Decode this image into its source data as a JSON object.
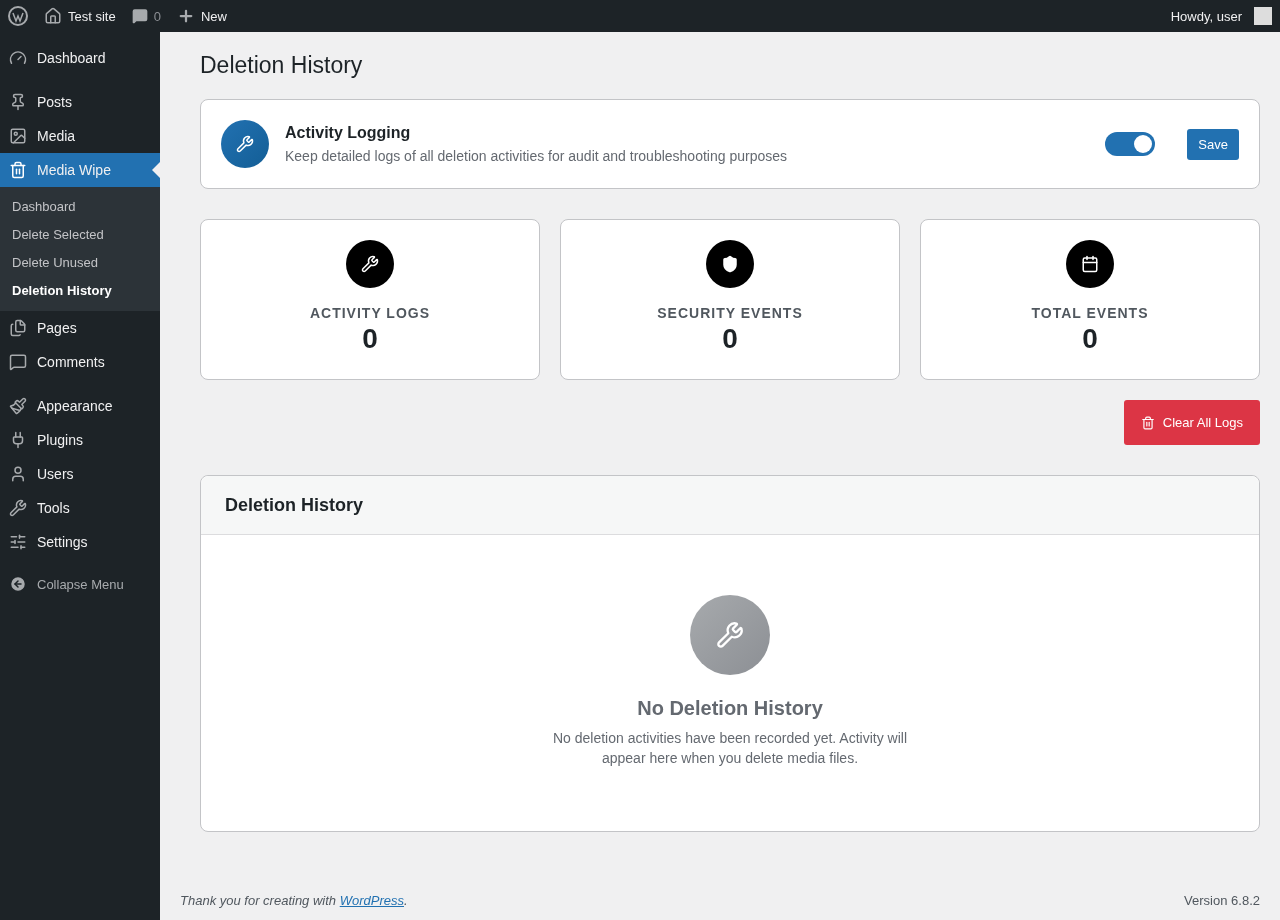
{
  "admin_bar": {
    "site_name": "Test site",
    "comments_count": "0",
    "new_label": "New",
    "greeting": "Howdy, user"
  },
  "sidebar": {
    "groups": [
      [
        {
          "label": "Dashboard",
          "selected": false
        }
      ],
      [
        {
          "label": "Posts",
          "selected": false
        },
        {
          "label": "Media",
          "selected": false
        },
        {
          "label": "Media Wipe",
          "selected": true,
          "children": [
            {
              "label": "Dashboard",
              "selected": false
            },
            {
              "label": "Delete Selected",
              "selected": false
            },
            {
              "label": "Delete Unused",
              "selected": false
            },
            {
              "label": "Deletion History",
              "selected": true
            }
          ]
        },
        {
          "label": "Pages",
          "selected": false
        },
        {
          "label": "Comments",
          "selected": false
        }
      ],
      [
        {
          "label": "Appearance",
          "selected": false
        },
        {
          "label": "Plugins",
          "selected": false
        },
        {
          "label": "Users",
          "selected": false
        },
        {
          "label": "Tools",
          "selected": false
        },
        {
          "label": "Settings",
          "selected": false
        }
      ]
    ],
    "collapse_label": "Collapse Menu"
  },
  "page_title": "Deletion History",
  "logging": {
    "title": "Activity Logging",
    "description": "Keep detailed logs of all deletion activities for audit and troubleshooting purposes",
    "on": true,
    "save_label": "Save"
  },
  "stats": [
    {
      "label": "ACTIVITY LOGS",
      "value": "0"
    },
    {
      "label": "SECURITY EVENTS",
      "value": "0"
    },
    {
      "label": "TOTAL EVENTS",
      "value": "0"
    }
  ],
  "clear_label": "Clear All Logs",
  "history": {
    "title": "Deletion History",
    "empty_title": "No Deletion History",
    "empty_text": "No deletion activities have been recorded yet. Activity will appear here when you delete media files."
  },
  "footer": {
    "thanks": "Thank you for creating with",
    "link": "WordPress",
    "after": ".",
    "version": "Version 6.8.2"
  }
}
